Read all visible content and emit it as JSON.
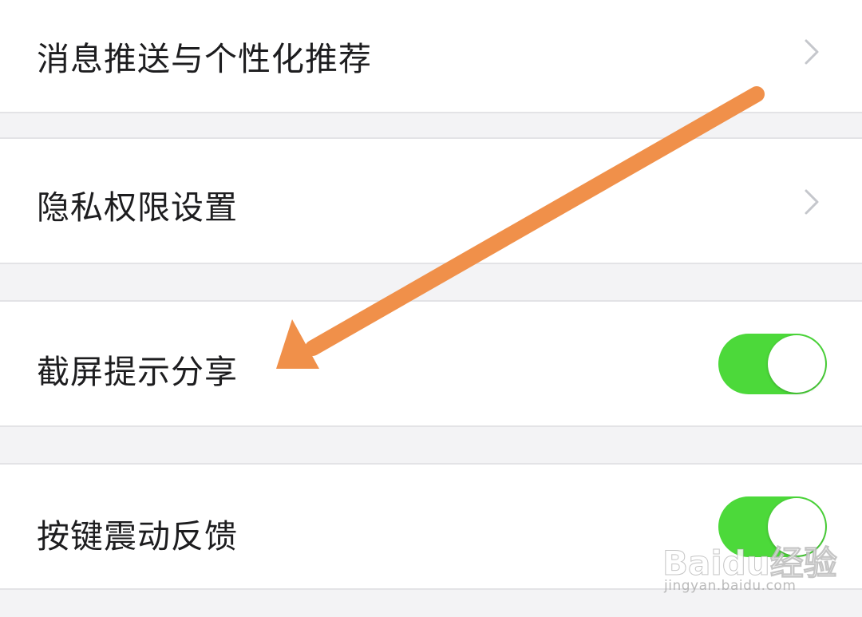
{
  "settings": {
    "items": [
      {
        "label": "消息推送与个性化推荐",
        "control": "chevron"
      },
      {
        "label": "隐私权限设置",
        "control": "chevron"
      },
      {
        "label": "截屏提示分享",
        "control": "toggle",
        "state": "on"
      },
      {
        "label": "按键震动反馈",
        "control": "toggle",
        "state": "on"
      }
    ]
  },
  "colors": {
    "toggle_on": "#4cd93a",
    "annotation_arrow": "#f0904a",
    "background": "#f3f3f5",
    "row": "#ffffff"
  },
  "icons": {
    "chevron": "chevron-right-icon",
    "arrow": "annotation-arrow-icon"
  },
  "watermark": {
    "logo": "Baidu经验",
    "url": "jingyan.baidu.com"
  }
}
